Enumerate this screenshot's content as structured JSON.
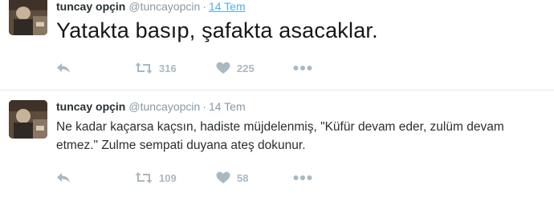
{
  "tweets": [
    {
      "name": "tuncay opçin",
      "handle": "@tuncayopcin",
      "separator": "·",
      "time": "14 Tem",
      "text": "Yatakta basıp, şafakta asacaklar.",
      "retweets": "316",
      "likes": "225",
      "icons": [
        "reply-icon",
        "retweet-icon",
        "heart-icon",
        "more-icon"
      ]
    },
    {
      "name": "tuncay opçin",
      "handle": "@tuncayopcin",
      "separator": "·",
      "time": "14 Tem",
      "text": "Ne kadar kaçarsa kaçsın, hadiste müjdelenmiş, \"Küfür devam eder, zulüm devam etmez.\" Zulme sempati duyana ateş dokunur.",
      "retweets": "109",
      "likes": "58",
      "icons": [
        "reply-icon",
        "retweet-icon",
        "heart-icon",
        "more-icon"
      ]
    }
  ],
  "colors": {
    "icon": "#aab8c2",
    "meta": "#8899a6",
    "link": "#55acee",
    "divider": "#e1e8ed"
  }
}
